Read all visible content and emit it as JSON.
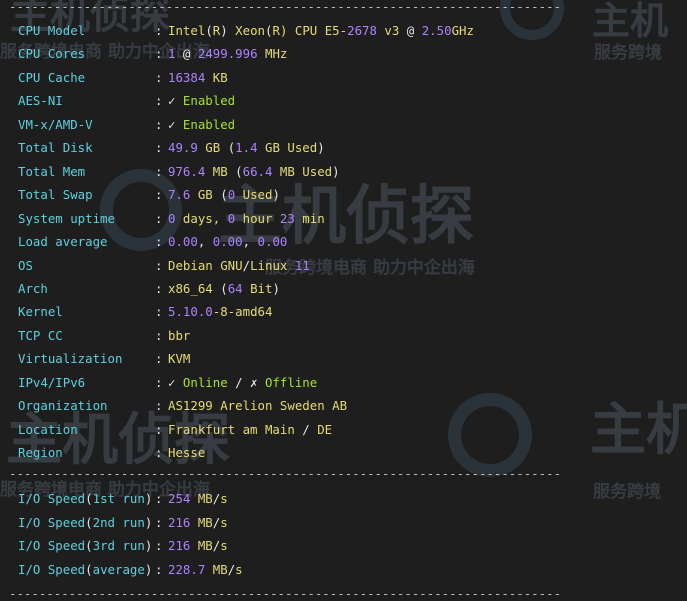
{
  "separator_top": "--------------------------------------------------------------------------",
  "separator_mid": "--------------------------------------------------------------------------",
  "separator_bottom": "--------------------------------------------------------------------------",
  "sysinfo": [
    {
      "key": "CPU Model",
      "sep": ":",
      "parts": [
        {
          "t": "Intel",
          "c": "y"
        },
        {
          "t": "(",
          "c": "w"
        },
        {
          "t": "R",
          "c": "y"
        },
        {
          "t": ")",
          "c": "w"
        },
        {
          "t": " Xeon",
          "c": "y"
        },
        {
          "t": "(",
          "c": "w"
        },
        {
          "t": "R",
          "c": "y"
        },
        {
          "t": ") CPU E5-",
          "c": "y"
        },
        {
          "t": "2678",
          "c": "p"
        },
        {
          "t": " v3 ",
          "c": "y"
        },
        {
          "t": "@",
          "c": "w"
        },
        {
          "t": " 2.50",
          "c": "p"
        },
        {
          "t": "GHz",
          "c": "y"
        }
      ]
    },
    {
      "key": "CPU Cores",
      "sep": ":",
      "parts": [
        {
          "t": "1",
          "c": "p"
        },
        {
          "t": " @ ",
          "c": "w"
        },
        {
          "t": "2499.996",
          "c": "p"
        },
        {
          "t": " MHz",
          "c": "y"
        }
      ]
    },
    {
      "key": "CPU Cache",
      "sep": ":",
      "parts": [
        {
          "t": "16384",
          "c": "p"
        },
        {
          "t": " KB",
          "c": "y"
        }
      ]
    },
    {
      "key": "AES-NI",
      "sep": ":",
      "parts": [
        {
          "t": "✓",
          "c": "w"
        },
        {
          "t": " Enabled",
          "c": "g"
        }
      ]
    },
    {
      "key": "VM-x/AMD-V",
      "sep": ":",
      "parts": [
        {
          "t": "✓",
          "c": "w"
        },
        {
          "t": " Enabled",
          "c": "g"
        }
      ]
    },
    {
      "key": "Total Disk",
      "sep": ":",
      "parts": [
        {
          "t": "49.9",
          "c": "p"
        },
        {
          "t": " GB ",
          "c": "y"
        },
        {
          "t": "(",
          "c": "w"
        },
        {
          "t": "1.4",
          "c": "p"
        },
        {
          "t": " GB Used",
          "c": "y"
        },
        {
          "t": ")",
          "c": "w"
        }
      ]
    },
    {
      "key": "Total Mem",
      "sep": ":",
      "parts": [
        {
          "t": "976.4",
          "c": "p"
        },
        {
          "t": " MB ",
          "c": "y"
        },
        {
          "t": "(",
          "c": "w"
        },
        {
          "t": "66.4",
          "c": "p"
        },
        {
          "t": " MB Used",
          "c": "y"
        },
        {
          "t": ")",
          "c": "w"
        }
      ]
    },
    {
      "key": "Total Swap",
      "sep": ":",
      "parts": [
        {
          "t": "7.6",
          "c": "p"
        },
        {
          "t": " GB ",
          "c": "y"
        },
        {
          "t": "(",
          "c": "w"
        },
        {
          "t": "0",
          "c": "p"
        },
        {
          "t": " Used",
          "c": "y"
        },
        {
          "t": ")",
          "c": "w"
        }
      ]
    },
    {
      "key": "System uptime",
      "sep": ":",
      "parts": [
        {
          "t": "0",
          "c": "p"
        },
        {
          "t": " days, ",
          "c": "y"
        },
        {
          "t": "0",
          "c": "p"
        },
        {
          "t": " hour ",
          "c": "y"
        },
        {
          "t": "23",
          "c": "p"
        },
        {
          "t": " min",
          "c": "y"
        }
      ]
    },
    {
      "key": "Load average",
      "sep": ":",
      "parts": [
        {
          "t": "0.00",
          "c": "p"
        },
        {
          "t": ", ",
          "c": "w"
        },
        {
          "t": "0.00",
          "c": "p"
        },
        {
          "t": ", ",
          "c": "w"
        },
        {
          "t": "0.00",
          "c": "p"
        }
      ]
    },
    {
      "key": "OS",
      "sep": ":",
      "parts": [
        {
          "t": "Debian GNU",
          "c": "y"
        },
        {
          "t": "/",
          "c": "w"
        },
        {
          "t": "Linux ",
          "c": "y"
        },
        {
          "t": "11",
          "c": "p"
        }
      ]
    },
    {
      "key": "Arch",
      "sep": ":",
      "parts": [
        {
          "t": "x86_64 ",
          "c": "y"
        },
        {
          "t": "(",
          "c": "w"
        },
        {
          "t": "64",
          "c": "p"
        },
        {
          "t": " Bit",
          "c": "y"
        },
        {
          "t": ")",
          "c": "w"
        }
      ]
    },
    {
      "key": "Kernel",
      "sep": ":",
      "parts": [
        {
          "t": "5.10.0",
          "c": "p"
        },
        {
          "t": "-8-amd64",
          "c": "y"
        }
      ]
    },
    {
      "key": "TCP CC",
      "sep": ":",
      "parts": [
        {
          "t": "bbr",
          "c": "y"
        }
      ]
    },
    {
      "key": "Virtualization",
      "sep": ":",
      "parts": [
        {
          "t": "KVM",
          "c": "y"
        }
      ]
    },
    {
      "key": "IPv4/IPv6",
      "sep": ":",
      "parts": [
        {
          "t": "✓",
          "c": "w"
        },
        {
          "t": " Online ",
          "c": "g"
        },
        {
          "t": "/",
          "c": "w"
        },
        {
          "t": " ✗",
          "c": "w"
        },
        {
          "t": " Offline",
          "c": "g"
        }
      ]
    },
    {
      "key": "Organization",
      "sep": ":",
      "parts": [
        {
          "t": "AS1299 Arelion Sweden AB",
          "c": "y"
        }
      ]
    },
    {
      "key": "Location",
      "sep": ":",
      "parts": [
        {
          "t": "Frankfurt am Main ",
          "c": "y"
        },
        {
          "t": "/",
          "c": "w"
        },
        {
          "t": " DE",
          "c": "y"
        }
      ]
    },
    {
      "key": "Region",
      "sep": ":",
      "parts": [
        {
          "t": "Hesse",
          "c": "y"
        }
      ]
    }
  ],
  "io": [
    {
      "key_parts": [
        {
          "t": "I/O Speed",
          "c": "k"
        },
        {
          "t": "(",
          "c": "w"
        },
        {
          "t": "1st run",
          "c": "k"
        },
        {
          "t": ")",
          "c": "w"
        }
      ],
      "sep": ":",
      "parts": [
        {
          "t": "254",
          "c": "p"
        },
        {
          "t": " MB",
          "c": "y"
        },
        {
          "t": "/",
          "c": "w"
        },
        {
          "t": "s",
          "c": "y"
        }
      ]
    },
    {
      "key_parts": [
        {
          "t": "I/O Speed",
          "c": "k"
        },
        {
          "t": "(",
          "c": "w"
        },
        {
          "t": "2nd run",
          "c": "k"
        },
        {
          "t": ")",
          "c": "w"
        }
      ],
      "sep": ":",
      "parts": [
        {
          "t": "216",
          "c": "p"
        },
        {
          "t": " MB",
          "c": "y"
        },
        {
          "t": "/",
          "c": "w"
        },
        {
          "t": "s",
          "c": "y"
        }
      ]
    },
    {
      "key_parts": [
        {
          "t": "I/O Speed",
          "c": "k"
        },
        {
          "t": "(",
          "c": "w"
        },
        {
          "t": "3rd run",
          "c": "k"
        },
        {
          "t": ")",
          "c": "w"
        }
      ],
      "sep": ":",
      "parts": [
        {
          "t": "216",
          "c": "p"
        },
        {
          "t": " MB",
          "c": "y"
        },
        {
          "t": "/",
          "c": "w"
        },
        {
          "t": "s",
          "c": "y"
        }
      ]
    },
    {
      "key_parts": [
        {
          "t": "I/O Speed",
          "c": "k"
        },
        {
          "t": "(",
          "c": "w"
        },
        {
          "t": "average",
          "c": "k"
        },
        {
          "t": ")",
          "c": "w"
        }
      ],
      "sep": ":",
      "parts": [
        {
          "t": "228.7",
          "c": "p"
        },
        {
          "t": " MB",
          "c": "y"
        },
        {
          "t": "/",
          "c": "w"
        },
        {
          "t": "s",
          "c": "y"
        }
      ]
    }
  ],
  "watermark": {
    "brand": "主机侦探",
    "slogan": "服务跨境电商 助力中企出海",
    "slogan_short": "服务跨境",
    "brand_short": "主机"
  },
  "colors": {
    "background": "#1e1e1e",
    "key": "#5fd0e0",
    "value_text": "#e6db74",
    "value_number": "#ae81ff",
    "status_ok": "#a6e22e",
    "punct": "#e6e6e6"
  }
}
